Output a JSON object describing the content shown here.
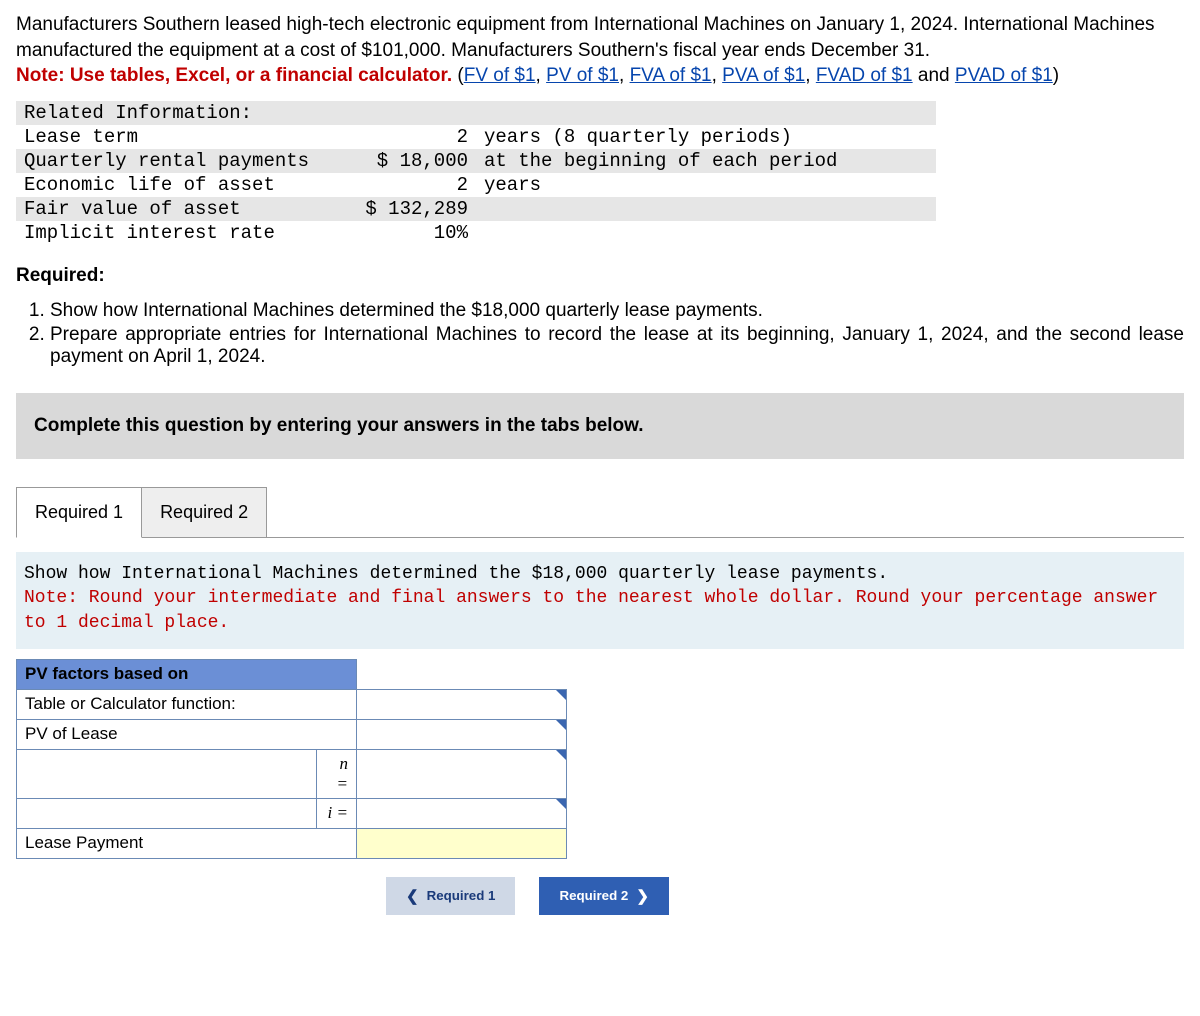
{
  "intro": {
    "p1": "Manufacturers Southern leased high-tech electronic equipment from International Machines on January 1, 2024. International Machines manufactured the equipment at a cost of $101,000. Manufacturers Southern's fiscal year ends December 31.",
    "note_prefix": "Note: Use tables, Excel, or a financial calculator.",
    "links": [
      "FV of $1",
      "PV of $1",
      "FVA of $1",
      "PVA of $1",
      "FVAD of $1"
    ],
    "link_sep": ", ",
    "and_word": " and ",
    "last_link": "PVAD of $1",
    "open_paren": " (",
    "close_paren": ")"
  },
  "info": {
    "header": "Related Information:",
    "rows": [
      {
        "label": "Lease term",
        "value": "2",
        "note": "years (8 quarterly periods)"
      },
      {
        "label": "Quarterly rental payments",
        "value": "$ 18,000",
        "note": "at the beginning of each period"
      },
      {
        "label": "Economic life of asset",
        "value": "2",
        "note": "years"
      },
      {
        "label": "Fair value of asset",
        "value": "$ 132,289",
        "note": ""
      },
      {
        "label": "Implicit interest rate",
        "value": "10%",
        "note": ""
      }
    ]
  },
  "required_hdr": "Required:",
  "required_items": [
    "Show how International Machines determined the $18,000 quarterly lease payments.",
    "Prepare appropriate entries for International Machines to record the lease at its beginning, January 1, 2024, and the second lease payment on April 1, 2024."
  ],
  "complete_bar": "Complete this question by entering your answers in the tabs below.",
  "tabs": {
    "t1": "Required 1",
    "t2": "Required 2"
  },
  "panel1": {
    "line1": "Show how International Machines determined the $18,000 quarterly lease payments.",
    "line2": "Note: Round your intermediate and final answers to the nearest whole dollar. Round your percentage answer to 1 decimal place."
  },
  "pv": {
    "header": "PV factors based on",
    "r1": "Table or Calculator function:",
    "r2": "PV of Lease",
    "n_eq": "n =",
    "i_eq": "i =",
    "lease_payment": "Lease Payment"
  },
  "nav": {
    "prev": "Required 1",
    "next": "Required 2"
  }
}
